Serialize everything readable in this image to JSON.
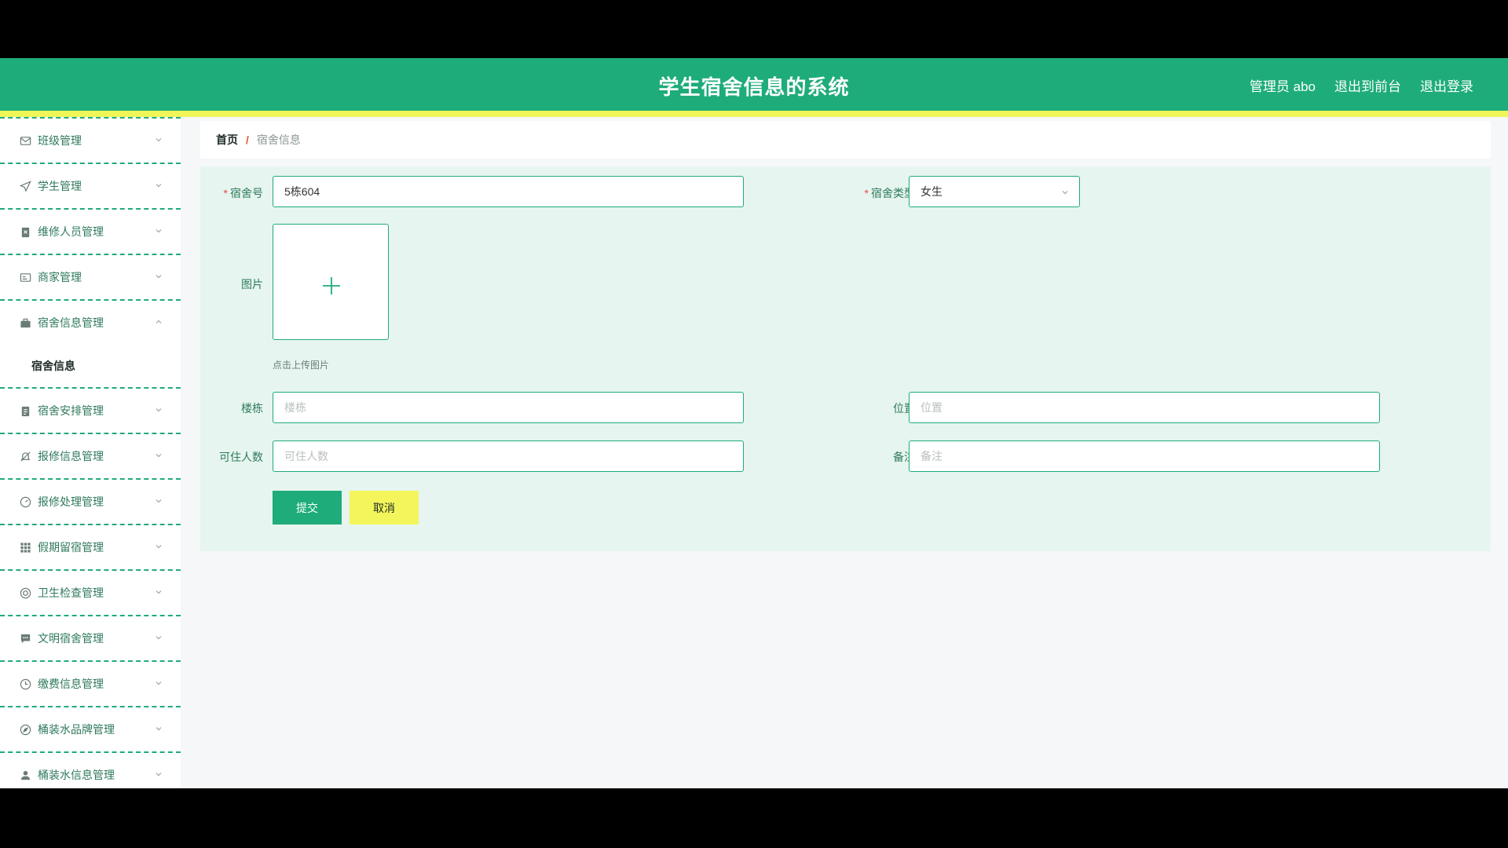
{
  "header": {
    "title": "学生宿舍信息的系统",
    "admin_label": "管理员 abo",
    "front_link": "退出到前台",
    "logout_link": "退出登录"
  },
  "sidebar": {
    "items": [
      {
        "label": "班级管理",
        "icon": "mail-icon"
      },
      {
        "label": "学生管理",
        "icon": "send-icon"
      },
      {
        "label": "维修人员管理",
        "icon": "clipboard-x-icon"
      },
      {
        "label": "商家管理",
        "icon": "id-card-icon"
      },
      {
        "label": "宿舍信息管理",
        "icon": "briefcase-icon",
        "expanded": true,
        "subitems": [
          "宿舍信息"
        ]
      },
      {
        "label": "宿舍安排管理",
        "icon": "clipboard-icon"
      },
      {
        "label": "报修信息管理",
        "icon": "bell-off-icon"
      },
      {
        "label": "报修处理管理",
        "icon": "gauge-icon"
      },
      {
        "label": "假期留宿管理",
        "icon": "grid-icon"
      },
      {
        "label": "卫生检查管理",
        "icon": "lifebuoy-icon"
      },
      {
        "label": "文明宿舍管理",
        "icon": "chat-icon"
      },
      {
        "label": "缴费信息管理",
        "icon": "clock-icon"
      },
      {
        "label": "桶装水品牌管理",
        "icon": "compass-icon"
      },
      {
        "label": "桶装水信息管理",
        "icon": "user-icon"
      }
    ]
  },
  "breadcrumb": {
    "home": "首页",
    "separator": "/",
    "current": "宿舍信息"
  },
  "form": {
    "dorm_no": {
      "label": "宿舍号",
      "required": true,
      "value": "5栋604"
    },
    "dorm_type": {
      "label": "宿舍类型",
      "required": true,
      "value": "女生"
    },
    "image": {
      "label": "图片",
      "hint": "点击上传图片"
    },
    "building": {
      "label": "楼栋",
      "placeholder": "楼栋"
    },
    "location": {
      "label": "位置",
      "placeholder": "位置"
    },
    "capacity": {
      "label": "可住人数",
      "placeholder": "可住人数"
    },
    "remark": {
      "label": "备注",
      "placeholder": "备注"
    },
    "submit_label": "提交",
    "cancel_label": "取消"
  },
  "colors": {
    "primary": "#1eac7a",
    "accent_yellow": "#f0f55a",
    "panel_bg": "#e6f5ef",
    "required": "#e64b4b"
  }
}
